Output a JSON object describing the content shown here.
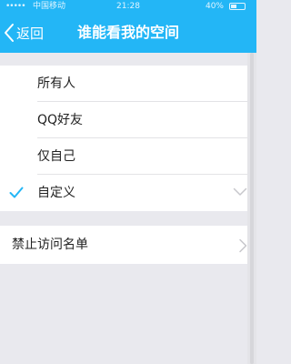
{
  "status_bar": {
    "signal": "•••••",
    "carrier": "中国移动",
    "time": "21:28",
    "battery_text": "40%",
    "battery_level": 0.4
  },
  "nav": {
    "back_label": "返回",
    "title": "谁能看我的空间",
    "accent_color": "#23b6f6"
  },
  "visibility_options": [
    {
      "label": "所有人",
      "selected": false
    },
    {
      "label": "QQ好友",
      "selected": false
    },
    {
      "label": "仅自己",
      "selected": false
    },
    {
      "label": "自定义",
      "selected": true
    }
  ],
  "blocked_list": {
    "label": "禁止访问名单"
  },
  "icons": {
    "back": "chevron-left-icon",
    "check": "checkmark-icon",
    "expand": "chevron-down-icon",
    "go": "chevron-right-icon"
  }
}
